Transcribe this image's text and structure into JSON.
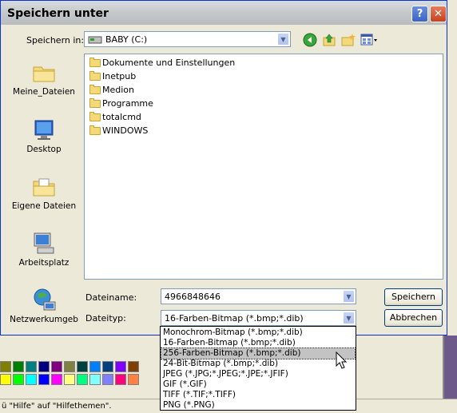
{
  "dialog": {
    "title": "Speichern unter",
    "help_glyph": "?",
    "close_glyph": "✕"
  },
  "save_in": {
    "label": "Speichern in:",
    "value": "BABY (C:)"
  },
  "nav_icons": [
    "back-icon",
    "up-folder-icon",
    "new-folder-icon",
    "view-menu-icon"
  ],
  "places": [
    {
      "label": "Meine_Dateien",
      "icon": "my-files-icon"
    },
    {
      "label": "Desktop",
      "icon": "desktop-icon"
    },
    {
      "label": "Eigene Dateien",
      "icon": "my-documents-icon"
    },
    {
      "label": "Arbeitsplatz",
      "icon": "my-computer-icon"
    },
    {
      "label": "Netzwerkumgeb",
      "icon": "network-icon"
    }
  ],
  "files": [
    "Dokumente und Einstellungen",
    "Inetpub",
    "Medion",
    "Programme",
    "totalcmd",
    "WINDOWS"
  ],
  "filename": {
    "label": "Dateiname:",
    "value": "4966848646"
  },
  "filetype": {
    "label": "Dateityp:",
    "value": "16-Farben-Bitmap (*.bmp;*.dib)"
  },
  "buttons": {
    "save": "Speichern",
    "cancel": "Abbrechen"
  },
  "filetype_options": [
    "Monochrom-Bitmap (*.bmp;*.dib)",
    "16-Farben-Bitmap (*.bmp;*.dib)",
    "256-Farben-Bitmap (*.bmp;*.dib)",
    "24-Bit-Bitmap (*.bmp;*.dib)",
    "JPEG (*.JPG;*.JPEG;*.JPE;*.JFIF)",
    "GIF (*.GIF)",
    "TIFF (*.TIF;*.TIFF)",
    "PNG (*.PNG)"
  ],
  "selected_option_index": 2,
  "palette_colors": [
    "#808000",
    "#008000",
    "#008080",
    "#000080",
    "#800080",
    "#808040",
    "#004040",
    "#0080ff",
    "#004080",
    "#8000ff",
    "#804000",
    "#ffff00",
    "#00ff00",
    "#00ffff",
    "#0000ff",
    "#ff00ff",
    "#ffff80",
    "#00ff80",
    "#80ffff",
    "#8080ff",
    "#ff0080",
    "#ff8040"
  ],
  "status_text": "ü \"Hilfe\" auf \"Hilfethemen\"."
}
